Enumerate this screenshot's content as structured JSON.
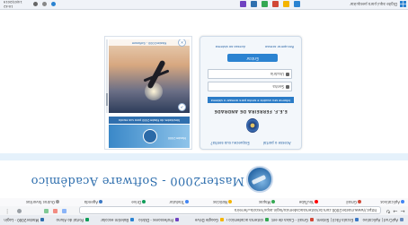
{
  "browser": {
    "tabs": [
      {
        "label": "ApiCrud | Aplicativo 4.2",
        "color": "#6b8cbf"
      },
      {
        "label": "Escola Fácil | Sistema",
        "color": "#3b78c4"
      },
      {
        "label": "Gmail - Caixa de entrada",
        "color": "#d14836"
      },
      {
        "label": "sistema academico online",
        "color": "#34a853"
      },
      {
        "label": "Google Drive",
        "color": "#f4b400"
      },
      {
        "label": "Professores - Diário",
        "color": "#6f42c1"
      },
      {
        "label": "Boletim escolar",
        "color": "#2b83d1"
      },
      {
        "label": "Portal do Aluno",
        "color": "#0f9d58"
      },
      {
        "label": "Master2000 - Login",
        "color": "#2f6fae"
      }
    ],
    "url": "https://www.master2000.com.br/sistemaacademico/login.aspx?escola=ferreira",
    "bookmarks": [
      {
        "label": "Aplicativos",
        "color": "#4285f4"
      },
      {
        "label": "Gmail",
        "color": "#d14836"
      },
      {
        "label": "YouTube",
        "color": "#ff0000"
      },
      {
        "label": "Mapas",
        "color": "#34a853"
      },
      {
        "label": "Notícias",
        "color": "#f4b400"
      },
      {
        "label": "Tradutor",
        "color": "#4285f4"
      },
      {
        "label": "Drive",
        "color": "#0f9d58"
      },
      {
        "label": "Agenda",
        "color": "#3b78c4"
      },
      {
        "label": "Outros favoritos",
        "color": "#999999"
      }
    ]
  },
  "page": {
    "brand": "Master2000 - Software Acadêmico",
    "login": {
      "top_link_left": "Esqueceu sua senha?",
      "top_link_right": "Acesse o portal",
      "institution": "E.E.F. FERREIRA DE ANDRADE",
      "notice": "Informe seu usuário e senha para acessar o sistema",
      "user_placeholder": "Usuário",
      "password_placeholder": "Senha",
      "button_label": "Entrar",
      "foot_left": "Acesso ao sistema",
      "foot_right": "Recuperar acesso"
    },
    "news": {
      "top_title": "Master2000",
      "caption": "Novidades do Master2000 para sua escola",
      "header": "Master2000 - Software"
    }
  },
  "taskbar": {
    "search_text": "Digite aqui para pesquisar",
    "clock_time": "10:42",
    "clock_date": "14/03/2019",
    "apps": [
      "#2b83d1",
      "#f4b400",
      "#d14836",
      "#34a853",
      "#2f6fae",
      "#6f42c1"
    ],
    "tray": [
      "#2b83d1",
      "#888888",
      "#666666"
    ]
  }
}
